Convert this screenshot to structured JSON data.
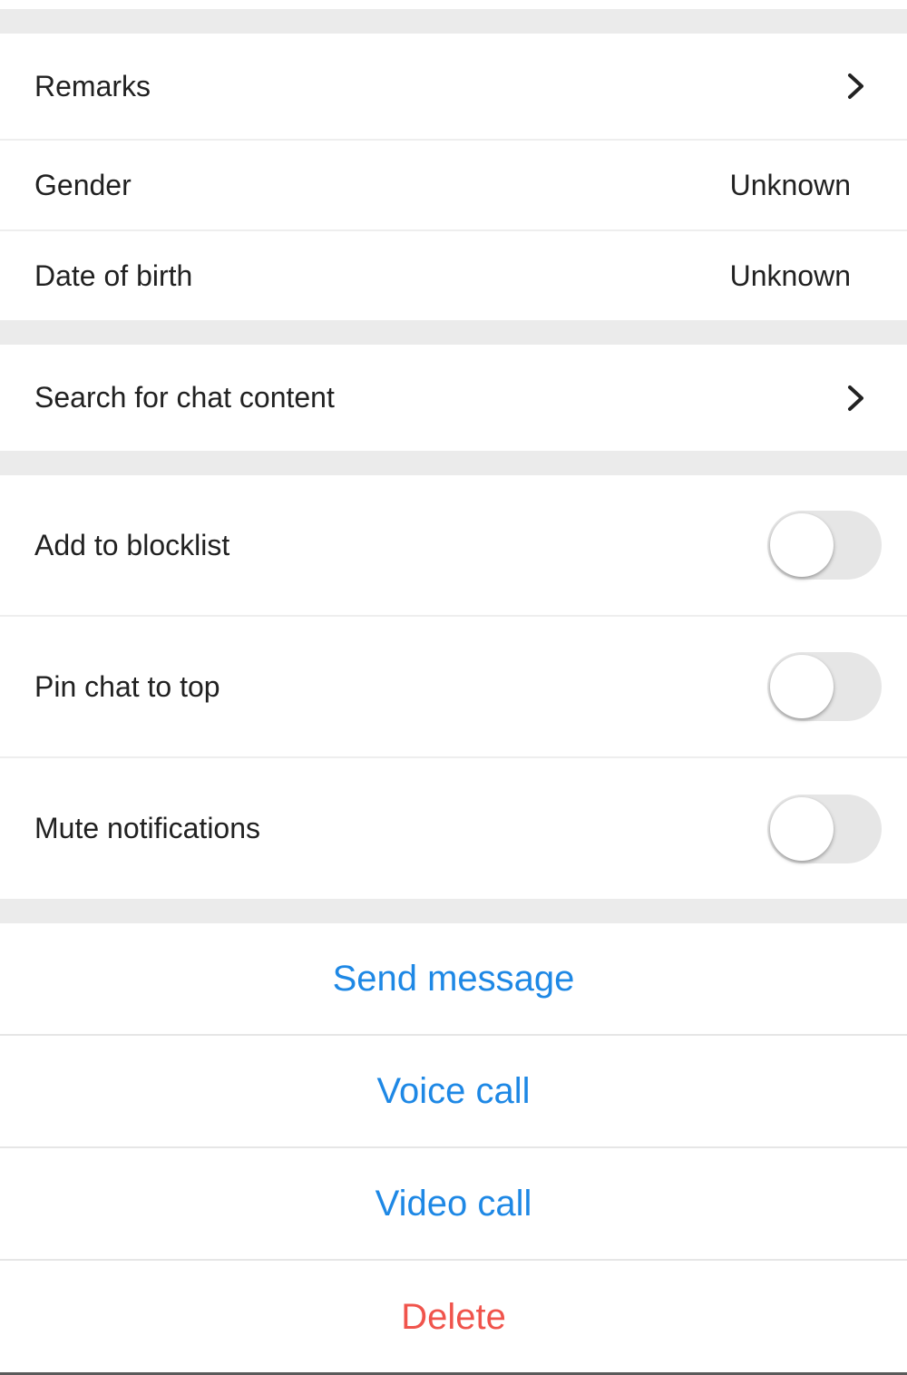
{
  "profile_group": {
    "remarks": {
      "label": "Remarks"
    },
    "gender": {
      "label": "Gender",
      "value": "Unknown"
    },
    "date_of_birth": {
      "label": "Date of birth",
      "value": "Unknown"
    }
  },
  "search_group": {
    "search_chat": {
      "label": "Search for chat content"
    }
  },
  "settings_group": {
    "items": [
      {
        "label": "Add to blocklist",
        "enabled": false
      },
      {
        "label": "Pin chat to top",
        "enabled": false
      },
      {
        "label": "Mute notifications",
        "enabled": false
      }
    ]
  },
  "actions": {
    "send_message": "Send message",
    "voice_call": "Voice call",
    "video_call": "Video call",
    "delete": "Delete"
  },
  "colors": {
    "accent_blue": "#1e88e5",
    "delete_red": "#f0544c",
    "toggle_off": "#e6e6e6",
    "section_bg": "#ebebeb"
  },
  "icons": {
    "chevron": "chevron-right-icon"
  }
}
